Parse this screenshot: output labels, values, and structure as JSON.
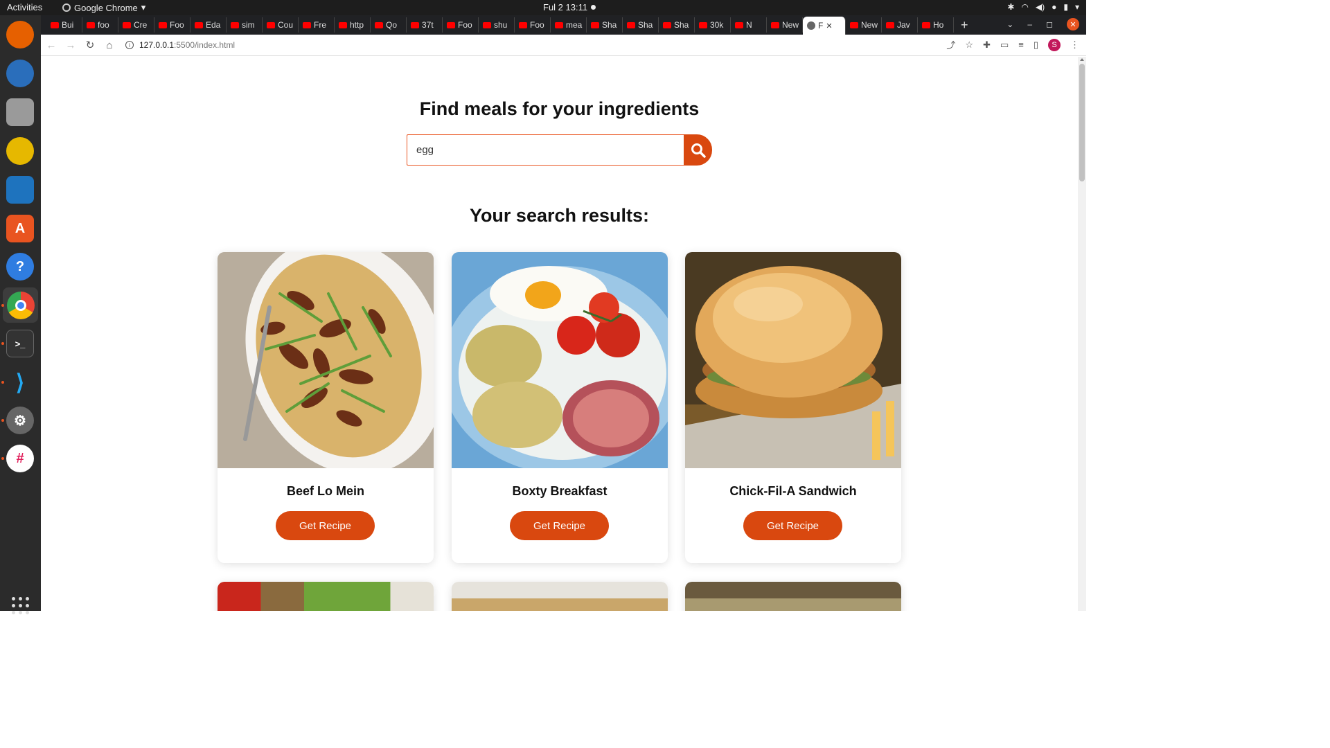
{
  "system": {
    "activities": "Activities",
    "app_name": "Google Chrome",
    "clock": "Ful 2  13:11"
  },
  "browser": {
    "tabs": [
      "Bui",
      "foo",
      "Cre",
      "Foo",
      "Eda",
      "sim",
      "Cou",
      "Fre",
      "http",
      "Qo",
      "37t",
      "Foo",
      "shu",
      "Foo",
      "mea",
      "Sha",
      "Sha",
      "Sha",
      "30k",
      "N",
      "New",
      "F",
      "New",
      "Jav",
      "Ho"
    ],
    "active_tab_index": 21,
    "url_host": "127.0.0.1",
    "url_path": ":5500/index.html",
    "profile_initial": "S"
  },
  "page": {
    "title": "Find meals for your ingredients",
    "search": {
      "value": "egg",
      "placeholder": ""
    },
    "results_title": "Your search results:",
    "meals": [
      {
        "name": "Beef Lo Mein",
        "button": "Get Recipe"
      },
      {
        "name": "Boxty Breakfast",
        "button": "Get Recipe"
      },
      {
        "name": "Chick-Fil-A Sandwich",
        "button": "Get Recipe"
      }
    ],
    "accent_color": "#d9480f"
  }
}
